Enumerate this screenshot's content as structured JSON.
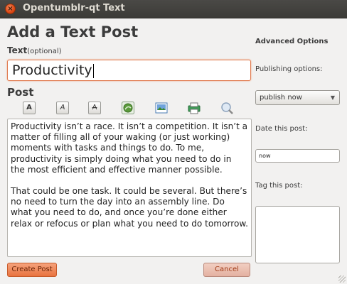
{
  "window": {
    "title": "Opentumblr-qt Text"
  },
  "form": {
    "heading": "Add a Text Post",
    "text_label": "Text",
    "text_optional": "(optional)",
    "title_value": "Productivity",
    "post_label": "Post",
    "post_paragraphs": [
      "Productivity isn’t a race. It isn’t a competition. It isn’t a matter of filling all of your waking (or just working) moments with tasks and things to do. To me, productivity is simply doing what you need to do in the most efficient and effective manner possible.",
      "That could be one task. It could be several. But there’s no need to turn the day into an assembly line. Do what you need to do, and once you’re done either relax or refocus or plan what you need to do tomorrow."
    ],
    "create_button": "Create Post",
    "cancel_button": "Cancel"
  },
  "toolbar": {
    "bold_glyph": "A",
    "italic_glyph": "A",
    "strike_glyph": "A",
    "icons": [
      "bold-icon",
      "italic-icon",
      "strikethrough-icon",
      "link-icon",
      "image-icon",
      "print-icon",
      "search-icon"
    ]
  },
  "sidebar": {
    "advanced_title": "Advanced Options",
    "publishing_label": "Publishing options:",
    "publishing_value": "publish now",
    "date_label": "Date this post:",
    "date_value": "now",
    "tag_label": "Tag this post:"
  },
  "colors": {
    "accent": "#dd4814",
    "create_button": "#e9733f",
    "cancel_button": "#e4b1a1"
  }
}
